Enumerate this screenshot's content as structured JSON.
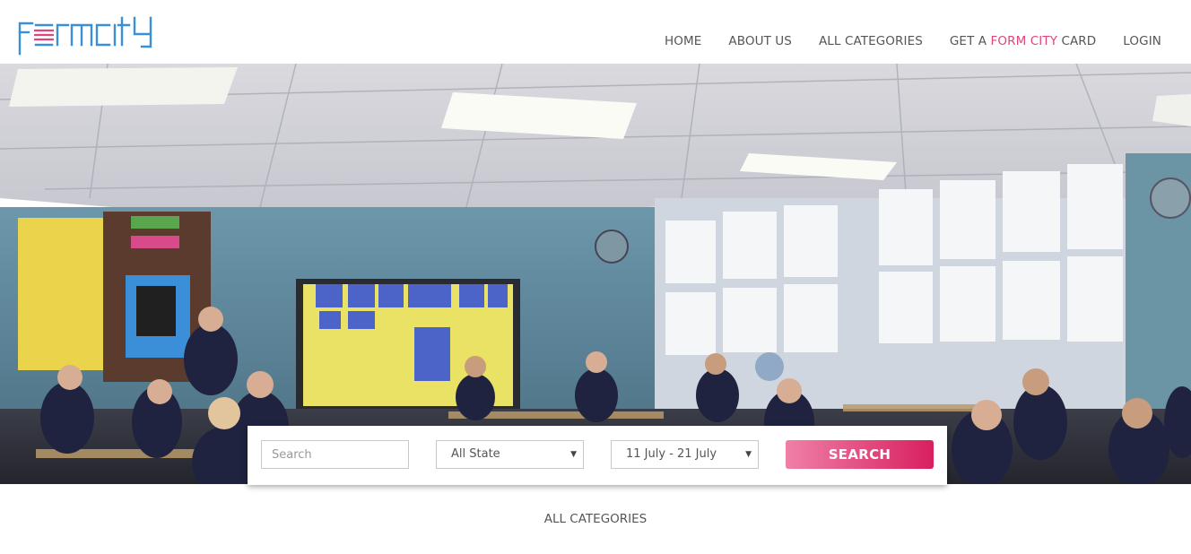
{
  "brand": {
    "logo_text": "formcity",
    "logo_color": "#3a8fd6",
    "accent_color": "#e0457b"
  },
  "nav": {
    "items": [
      {
        "label": "HOME"
      },
      {
        "label": "ABOUT US"
      },
      {
        "label": "ALL CATEGORIES"
      }
    ],
    "card_item": {
      "prefix": "GET A ",
      "highlight": "FORM CITY",
      "suffix": " CARD"
    },
    "login": {
      "label": "LOGIN"
    }
  },
  "hero": {
    "image": "classroom-photo"
  },
  "search": {
    "input_placeholder": "Search",
    "state_select": "All State",
    "date_select": "11 July - 21 July",
    "button_label": "SEARCH"
  },
  "section": {
    "title": "ALL CATEGORIES"
  }
}
